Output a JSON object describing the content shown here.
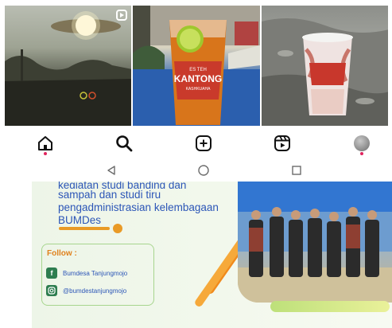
{
  "feed_grid": {
    "tiles": [
      {
        "name": "post-tile-sunset",
        "reel": true
      },
      {
        "name": "post-tile-kantong-drink",
        "reel": false,
        "cup_brand": "KANTONG",
        "cup_top": "ES TEH",
        "cup_sub": "KASHKUAHA"
      },
      {
        "name": "post-tile-sand-drink",
        "reel": false
      }
    ]
  },
  "bottom_nav": {
    "items": [
      "home-icon",
      "search-icon",
      "create-post-icon",
      "reels-icon",
      "profile-avatar"
    ],
    "notification_color": "#e0245e"
  },
  "system_nav": [
    "back-icon",
    "home-circle-icon",
    "recents-icon"
  ],
  "banner": {
    "cut_line": "kegiatan studi banding dan",
    "lines": [
      "sampah dan studi tiru",
      "pengadministrasian kelembagaan",
      "BUMDes"
    ],
    "follow_title": "Follow :",
    "facebook": "Bumdesa Tanjungmojo",
    "instagram": "@bumdestanjungmojo",
    "accent_color": "#e99a26",
    "text_color": "#2c56b7"
  }
}
